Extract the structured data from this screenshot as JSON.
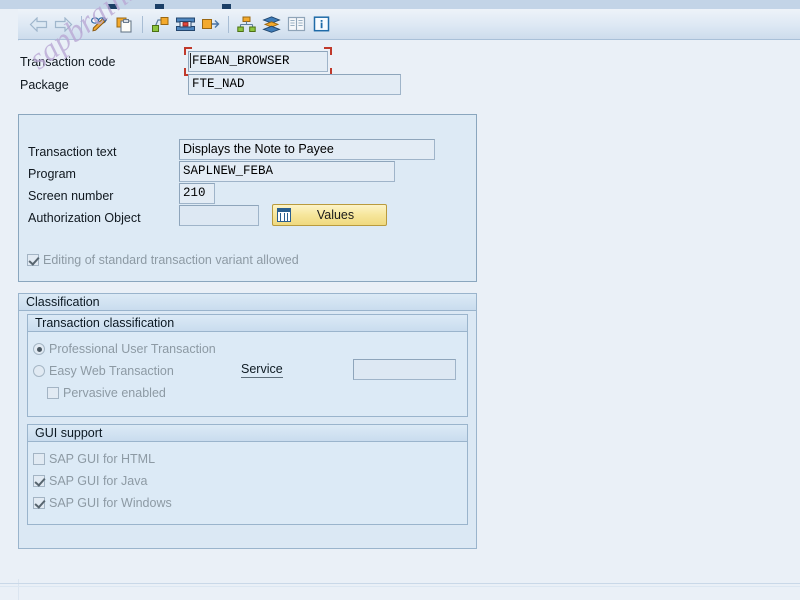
{
  "window": {
    "background_color": "#eaf0f7",
    "accent_color": "#c0392b",
    "button_color": "#f6e69b"
  },
  "watermark": {
    "text": "sapbrainsonline.com"
  },
  "toolbar": {
    "buttons": [
      {
        "icon": "back-arrow-icon",
        "tooltip": "Back"
      },
      {
        "icon": "forward-arrow-icon",
        "tooltip": "Forward"
      },
      {
        "icon": "display-change-icon",
        "tooltip": "Display <-> Change"
      },
      {
        "icon": "copy-object-icon",
        "tooltip": "Copy"
      },
      {
        "icon": "other-object-icon",
        "tooltip": "Other Object"
      },
      {
        "icon": "transport-icon",
        "tooltip": "Transport"
      },
      {
        "icon": "where-used-icon",
        "tooltip": "Where-Used List"
      },
      {
        "icon": "hierarchy-icon",
        "tooltip": "Object Hierarchy"
      },
      {
        "icon": "stack-icon",
        "tooltip": "Application Hierarchy"
      },
      {
        "icon": "documentation-icon",
        "tooltip": "Documentation"
      },
      {
        "icon": "info-icon",
        "tooltip": "Information"
      }
    ]
  },
  "header": {
    "transaction_code": {
      "label": "Transaction code",
      "value": "FEBAN_BROWSER",
      "focused": true
    },
    "package": {
      "label": "Package",
      "value": "FTE_NAD"
    }
  },
  "details": {
    "transaction_text": {
      "label": "Transaction text",
      "value": "Displays the Note to Payee"
    },
    "program": {
      "label": "Program",
      "value": "SAPLNEW_FEBA"
    },
    "screen_number": {
      "label": "Screen number",
      "value": "210"
    },
    "authorization_object": {
      "label": "Authorization Object",
      "value": ""
    },
    "values_button": {
      "label": "Values",
      "icon": "table-grid-icon"
    },
    "editing_allowed": {
      "label": "Editing of standard transaction variant allowed",
      "checked": true,
      "enabled": false
    }
  },
  "classification": {
    "title": "Classification",
    "transaction_classification": {
      "title": "Transaction classification",
      "options": [
        {
          "label": "Professional User Transaction",
          "selected": true,
          "enabled": false
        },
        {
          "label": "Easy Web Transaction",
          "selected": false,
          "enabled": false
        }
      ],
      "pervasive": {
        "label": "Pervasive enabled",
        "checked": false,
        "enabled": false
      },
      "service": {
        "label": "Service",
        "value": "",
        "enabled": true
      }
    },
    "gui_support": {
      "title": "GUI support",
      "items": [
        {
          "label": "SAP GUI for HTML",
          "checked": false,
          "enabled": false
        },
        {
          "label": "SAP GUI for Java",
          "checked": true,
          "enabled": false
        },
        {
          "label": "SAP GUI for Windows",
          "checked": true,
          "enabled": false
        }
      ]
    }
  }
}
